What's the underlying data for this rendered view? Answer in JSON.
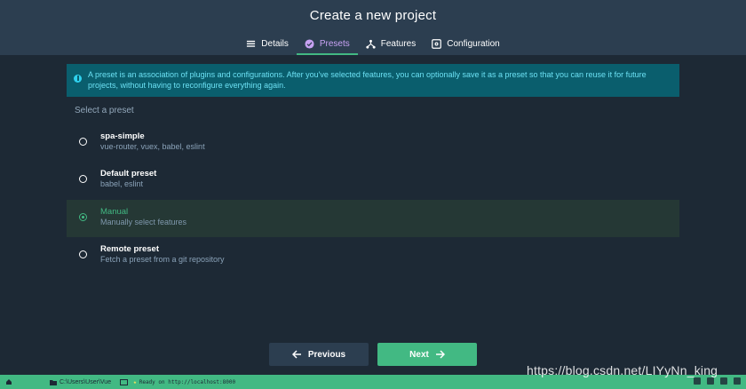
{
  "header": {
    "title": "Create a new project",
    "tabs": [
      {
        "label": "Details",
        "icon": "list-icon"
      },
      {
        "label": "Presets",
        "icon": "check-circle-icon",
        "active": true
      },
      {
        "label": "Features",
        "icon": "fork-icon"
      },
      {
        "label": "Configuration",
        "icon": "gear-box-icon"
      }
    ]
  },
  "info": {
    "text": "A preset is an association of plugins and configurations. After you've selected features, you can optionally save it as a preset so that you can reuse it for future projects, without having to reconfigure everything again."
  },
  "presets_section": {
    "label": "Select a preset",
    "items": [
      {
        "name": "spa-simple",
        "desc": "vue-router, vuex, babel, eslint",
        "selected": false
      },
      {
        "name": "Default preset",
        "desc": "babel, eslint",
        "selected": false
      },
      {
        "name": "Manual",
        "desc": "Manually select features",
        "selected": true
      },
      {
        "name": "Remote preset",
        "desc": "Fetch a preset from a git repository",
        "selected": false
      }
    ]
  },
  "actions": {
    "previous": "Previous",
    "next": "Next"
  },
  "statusbar": {
    "path": "C:\\Users\\User\\Vue",
    "ready": "Ready on http://localhost:8000"
  },
  "watermark": "https://blog.csdn.net/LIYyNn_king",
  "colors": {
    "accent": "#42b983",
    "header_bg": "#2c3e50",
    "body_bg": "#1d2935",
    "info_bg": "#0a5e6d",
    "info_text": "#6be0f3"
  }
}
